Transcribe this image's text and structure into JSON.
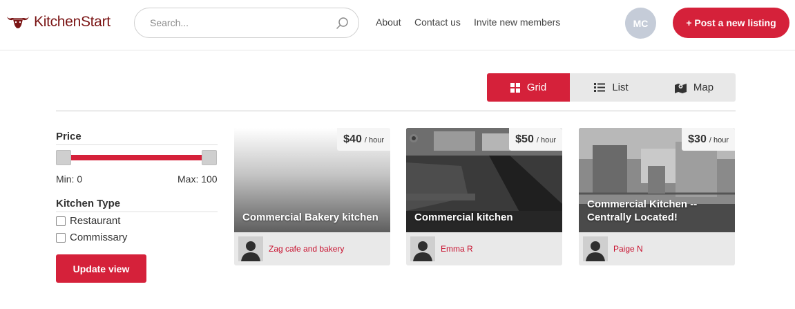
{
  "brand": {
    "name": "KitchenStart",
    "accent": "#d5213a",
    "logo_color": "#7a1414"
  },
  "search": {
    "placeholder": "Search...",
    "icon": "search-icon"
  },
  "nav": {
    "about": "About",
    "contact": "Contact us",
    "invite": "Invite new members"
  },
  "user": {
    "initials": "MC"
  },
  "post_button": "+ Post a new listing",
  "views": {
    "grid": "Grid",
    "list": "List",
    "map": "Map",
    "active": "grid"
  },
  "filters": {
    "price": {
      "title": "Price",
      "min_label": "Min: 0",
      "max_label": "Max: 100"
    },
    "kitchen_type": {
      "title": "Kitchen Type",
      "options": [
        "Restaurant",
        "Commissary"
      ]
    },
    "update_label": "Update view"
  },
  "listings": [
    {
      "title": "Commercial Bakery kitchen",
      "price": "$40",
      "unit": "/ hour",
      "owner": "Zag cafe and bakery"
    },
    {
      "title": "Commercial kitchen",
      "price": "$50",
      "unit": "/ hour",
      "owner": "Emma R"
    },
    {
      "title": "Commercial Kitchen -- Centrally Located!",
      "price": "$30",
      "unit": "/ hour",
      "owner": "Paige N"
    }
  ]
}
